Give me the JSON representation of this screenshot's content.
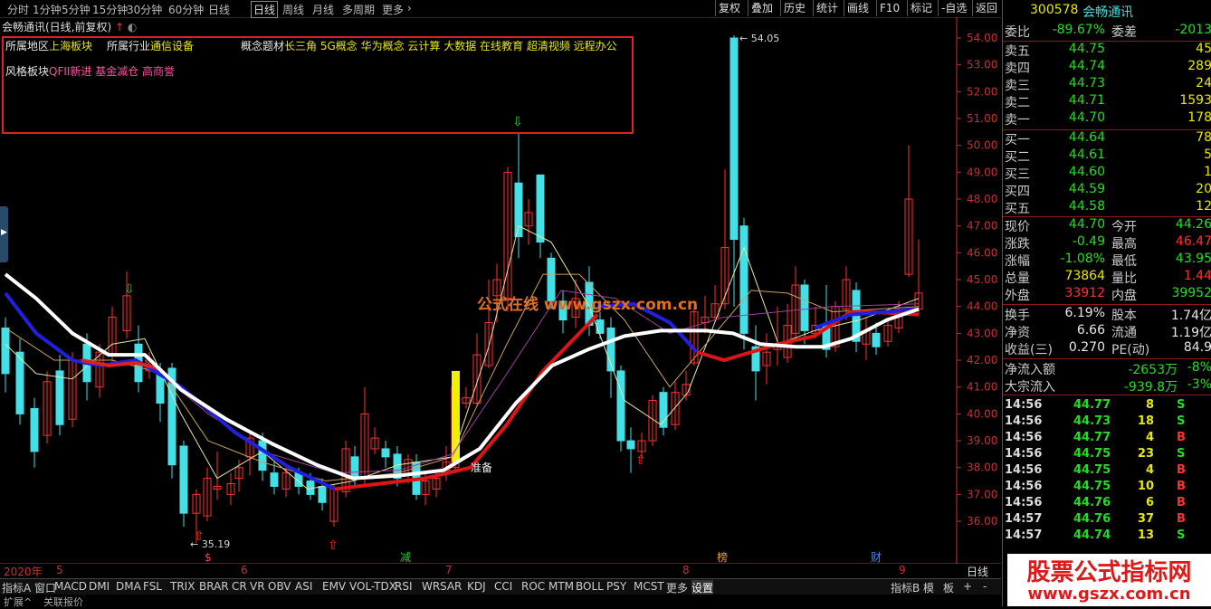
{
  "period_tabs": [
    "分时",
    "1分钟",
    "5分钟",
    "15分钟",
    "30分钟",
    "60分钟",
    "日线",
    "周线",
    "月线",
    "多周期",
    "更多"
  ],
  "active_period": "日线",
  "right_tools": [
    "复权",
    "叠加",
    "历史",
    "统计",
    "画线",
    "F10",
    "标记",
    "-自选",
    "返回"
  ],
  "stock_title": "会畅通讯(日线,前复权)",
  "info": {
    "region_label": "所属地区",
    "region_value": "上海板块",
    "industry_label": "所属行业",
    "industry_value": "通信设备",
    "concept_label": "概念题材",
    "concept_value": "长三角 5G概念 华为概念 云计算 大数据 在线教育 超清视频 远程办公",
    "style_label": "风格板块",
    "style_value": "QFII新进 基金减仓 高商誉"
  },
  "watermark": "公式在线 www.gszx.com.cn",
  "price_axis": [
    "54.00",
    "53.00",
    "52.00",
    "51.00",
    "50.00",
    "49.00",
    "48.00",
    "47.00",
    "46.00",
    "45.00",
    "44.00",
    "43.00",
    "42.00",
    "41.00",
    "40.00",
    "39.00",
    "38.00",
    "37.00",
    "36.00"
  ],
  "chart_annotations": {
    "high_label": "54.05",
    "low_label": "35.19",
    "ready_label": "准备",
    "event_jian": "减",
    "event_bang": "榜",
    "event_cai": "财",
    "event_s": "$"
  },
  "time_axis": [
    "2020年",
    "5",
    "6",
    "7",
    "8",
    "9",
    "日线"
  ],
  "indicator_tabs": [
    "指标A",
    "窗口",
    "MACD",
    "DMI",
    "DMA",
    "FSL",
    "TRIX",
    "BRAR",
    "CR",
    "VR",
    "OBV",
    "ASI",
    "EMV",
    "VOL-TDX",
    "RSI",
    "WR",
    "SAR",
    "KDJ",
    "CCI",
    "ROC",
    "MTM",
    "BOLL",
    "PSY",
    "MCST",
    "更多",
    "设置",
    "指标B",
    "模",
    "板",
    "+",
    "-"
  ],
  "ext_tabs": [
    "扩展^",
    "关联报价"
  ],
  "panel": {
    "code": "300578",
    "name": "会畅通讯",
    "weibi_label": "委比",
    "weibi": "-89.67%",
    "weicha_label": "委差",
    "weicha": "-2013",
    "asks": [
      {
        "label": "卖五",
        "price": "44.75",
        "vol": "45"
      },
      {
        "label": "卖四",
        "price": "44.74",
        "vol": "289"
      },
      {
        "label": "卖三",
        "price": "44.73",
        "vol": "24"
      },
      {
        "label": "卖二",
        "price": "44.71",
        "vol": "1593"
      },
      {
        "label": "卖一",
        "price": "44.70",
        "vol": "178"
      }
    ],
    "bids": [
      {
        "label": "买一",
        "price": "44.64",
        "vol": "78"
      },
      {
        "label": "买二",
        "price": "44.61",
        "vol": "5"
      },
      {
        "label": "买三",
        "price": "44.60",
        "vol": "1"
      },
      {
        "label": "买四",
        "price": "44.59",
        "vol": "20"
      },
      {
        "label": "买五",
        "price": "44.58",
        "vol": "12"
      }
    ],
    "stats": [
      {
        "l1": "现价",
        "v1": "44.70",
        "c1": "green",
        "l2": "今开",
        "v2": "44.26",
        "c2": "green"
      },
      {
        "l1": "涨跌",
        "v1": "-0.49",
        "c1": "green",
        "l2": "最高",
        "v2": "46.47",
        "c2": "red"
      },
      {
        "l1": "涨幅",
        "v1": "-1.08%",
        "c1": "green",
        "l2": "最低",
        "v2": "43.95",
        "c2": "green"
      },
      {
        "l1": "总量",
        "v1": "73864",
        "c1": "yellow",
        "l2": "量比",
        "v2": "1.44",
        "c2": "red"
      },
      {
        "l1": "外盘",
        "v1": "33912",
        "c1": "red",
        "l2": "内盘",
        "v2": "39952",
        "c2": "green"
      }
    ],
    "stats2": [
      {
        "l1": "换手",
        "v1": "6.19%",
        "c1": "white",
        "l2": "股本",
        "v2": "1.74亿",
        "c2": "white"
      },
      {
        "l1": "净资",
        "v1": "6.66",
        "c1": "white",
        "l2": "流通",
        "v2": "1.19亿",
        "c2": "white"
      },
      {
        "l1": "收益(三)",
        "v1": "0.270",
        "c1": "white",
        "l2": "PE(动)",
        "v2": "84.9",
        "c2": "white"
      }
    ],
    "flows": [
      {
        "label": "净流入额",
        "value": "-2653万",
        "pct": "-8%"
      },
      {
        "label": "大宗流入",
        "value": "-939.8万",
        "pct": "-3%"
      }
    ],
    "ticks": [
      {
        "t": "14:56",
        "p": "44.77",
        "v": "8",
        "d": "S"
      },
      {
        "t": "14:56",
        "p": "44.73",
        "v": "18",
        "d": "S"
      },
      {
        "t": "14:56",
        "p": "44.77",
        "v": "4",
        "d": "B"
      },
      {
        "t": "14:56",
        "p": "44.75",
        "v": "23",
        "d": "S"
      },
      {
        "t": "14:56",
        "p": "44.75",
        "v": "4",
        "d": "B"
      },
      {
        "t": "14:56",
        "p": "44.75",
        "v": "10",
        "d": "B"
      },
      {
        "t": "14:56",
        "p": "44.76",
        "v": "6",
        "d": "B"
      },
      {
        "t": "14:57",
        "p": "44.76",
        "v": "37",
        "d": "B"
      },
      {
        "t": "14:57",
        "p": "44.74",
        "v": "13",
        "d": "S"
      }
    ]
  },
  "brand": {
    "title": "股票公式指标网",
    "url": "www.gszx.com.cn"
  },
  "colors": {
    "up": "#ff3030",
    "down": "#44e0e8",
    "box": "#e02020"
  }
}
